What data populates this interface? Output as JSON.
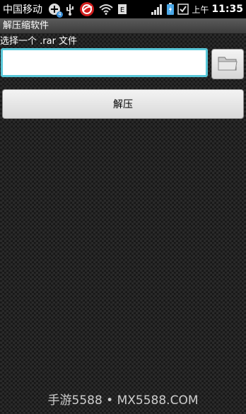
{
  "status_bar": {
    "carrier": "中国移动",
    "badge_count": "4",
    "am_pm": "上午",
    "time": "11:35",
    "icons": [
      "sync-icon",
      "usb-icon",
      "security-app-icon",
      "wifi-icon",
      "notification-icon",
      "signal-icon",
      "battery-icon",
      "checkbox-icon"
    ]
  },
  "app": {
    "title": "解压缩软件"
  },
  "main": {
    "prompt": "选择一个 .rar 文件",
    "path_value": "",
    "browse_icon": "folder-icon",
    "extract_label": "解压"
  },
  "watermark": "手游5588 • MX5588.COM"
}
